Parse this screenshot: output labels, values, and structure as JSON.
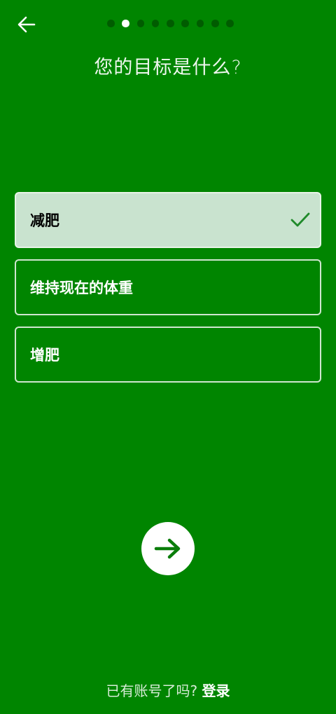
{
  "header": {
    "title": "您的目标是什么?",
    "progress": {
      "total": 9,
      "current": 2
    }
  },
  "options": [
    {
      "label": "减肥",
      "selected": true
    },
    {
      "label": "维持现在的体重",
      "selected": false
    },
    {
      "label": "增肥",
      "selected": false
    }
  ],
  "footer": {
    "prompt": "已有账号了吗? ",
    "login_label": "登录"
  },
  "colors": {
    "background": "#008500",
    "selected_fill": "#c9e3cf",
    "check": "#1f8a2a",
    "arrow": "#0a7d0a"
  },
  "icons": {
    "back": "arrow-left-icon",
    "check": "checkmark-icon",
    "next": "arrow-right-icon"
  }
}
